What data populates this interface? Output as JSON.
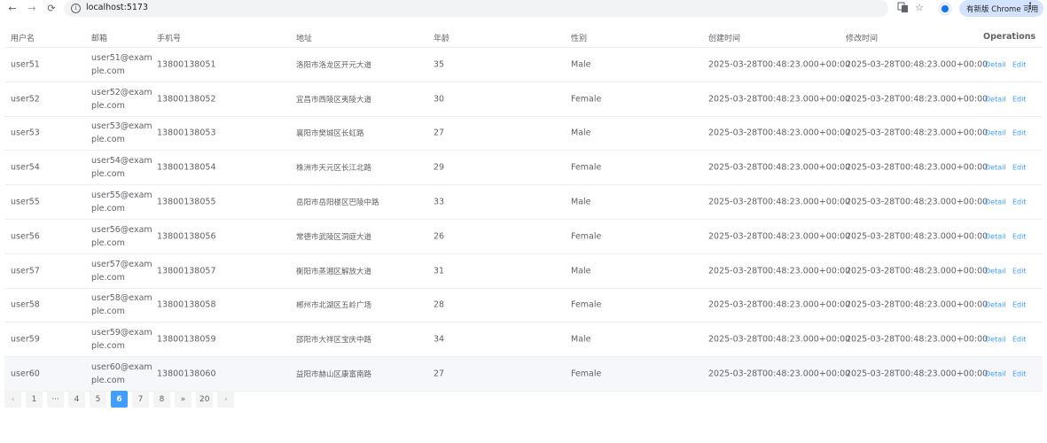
{
  "browser": {
    "url": "localhost:5173",
    "update_label": "有新版 Chrome 可用",
    "icons": [
      "back-icon",
      "forward-icon",
      "reload-icon",
      "info-icon",
      "translate-icon",
      "star-icon",
      "profile-icon",
      "menu-icon"
    ]
  },
  "table": {
    "headers": {
      "username": "用户名",
      "email": "邮箱",
      "phone": "手机号",
      "address": "地址",
      "age": "年龄",
      "gender": "性别",
      "created": "创建时间",
      "updated": "修改时间",
      "operations": "Operations"
    },
    "detail_label": "Detail",
    "edit_label": "Edit",
    "rows": [
      {
        "username": "user51",
        "email_line1": "user51@exam",
        "email_line2": "ple.com",
        "phone": "13800138051",
        "address": "洛阳市洛龙区开元大道",
        "age": "35",
        "gender": "Male",
        "created": "2025-03-28T00:48:23.000+00:00",
        "updated": "2025-03-28T00:48:23.000+00:00"
      },
      {
        "username": "user52",
        "email_line1": "user52@exam",
        "email_line2": "ple.com",
        "phone": "13800138052",
        "address": "宜昌市西陵区夷陵大道",
        "age": "30",
        "gender": "Female",
        "created": "2025-03-28T00:48:23.000+00:00",
        "updated": "2025-03-28T00:48:23.000+00:00"
      },
      {
        "username": "user53",
        "email_line1": "user53@exam",
        "email_line2": "ple.com",
        "phone": "13800138053",
        "address": "襄阳市樊城区长虹路",
        "age": "27",
        "gender": "Male",
        "created": "2025-03-28T00:48:23.000+00:00",
        "updated": "2025-03-28T00:48:23.000+00:00"
      },
      {
        "username": "user54",
        "email_line1": "user54@exam",
        "email_line2": "ple.com",
        "phone": "13800138054",
        "address": "株洲市天元区长江北路",
        "age": "29",
        "gender": "Female",
        "created": "2025-03-28T00:48:23.000+00:00",
        "updated": "2025-03-28T00:48:23.000+00:00"
      },
      {
        "username": "user55",
        "email_line1": "user55@exam",
        "email_line2": "ple.com",
        "phone": "13800138055",
        "address": "岳阳市岳阳楼区巴陵中路",
        "age": "33",
        "gender": "Male",
        "created": "2025-03-28T00:48:23.000+00:00",
        "updated": "2025-03-28T00:48:23.000+00:00"
      },
      {
        "username": "user56",
        "email_line1": "user56@exam",
        "email_line2": "ple.com",
        "phone": "13800138056",
        "address": "常德市武陵区洞庭大道",
        "age": "26",
        "gender": "Female",
        "created": "2025-03-28T00:48:23.000+00:00",
        "updated": "2025-03-28T00:48:23.000+00:00"
      },
      {
        "username": "user57",
        "email_line1": "user57@exam",
        "email_line2": "ple.com",
        "phone": "13800138057",
        "address": "衡阳市蒸湘区解放大道",
        "age": "31",
        "gender": "Male",
        "created": "2025-03-28T00:48:23.000+00:00",
        "updated": "2025-03-28T00:48:23.000+00:00"
      },
      {
        "username": "user58",
        "email_line1": "user58@exam",
        "email_line2": "ple.com",
        "phone": "13800138058",
        "address": "郴州市北湖区五岭广场",
        "age": "28",
        "gender": "Female",
        "created": "2025-03-28T00:48:23.000+00:00",
        "updated": "2025-03-28T00:48:23.000+00:00"
      },
      {
        "username": "user59",
        "email_line1": "user59@exam",
        "email_line2": "ple.com",
        "phone": "13800138059",
        "address": "邵阳市大祥区宝庆中路",
        "age": "34",
        "gender": "Male",
        "created": "2025-03-28T00:48:23.000+00:00",
        "updated": "2025-03-28T00:48:23.000+00:00"
      },
      {
        "username": "user60",
        "email_line1": "user60@exam",
        "email_line2": "ple.com",
        "phone": "13800138060",
        "address": "益阳市赫山区康富南路",
        "age": "27",
        "gender": "Female",
        "created": "2025-03-28T00:48:23.000+00:00",
        "updated": "2025-03-28T00:48:23.000+00:00"
      }
    ]
  },
  "pagination": {
    "prev": "‹",
    "first": "1",
    "ellipsis": "···",
    "pages": [
      "4",
      "5",
      "6",
      "7",
      "8"
    ],
    "current": "6",
    "jump_next": "»",
    "last": "20",
    "next": "›"
  },
  "colors": {
    "accent": "#409eff",
    "border": "#ebeef5",
    "text": "#606266",
    "hover_row": "#f5f7fa"
  }
}
